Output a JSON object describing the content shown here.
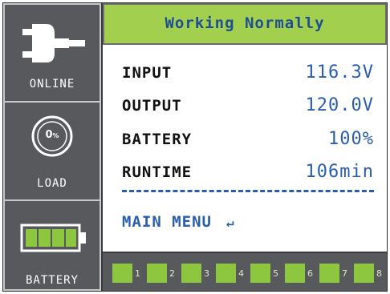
{
  "sidebar": {
    "online_label": "ONLINE",
    "load_label": "LOAD",
    "load_value": "0",
    "load_unit": "%",
    "battery_label": "BATTERY",
    "battery_level_fraction": 1.0
  },
  "status": {
    "text": "Working Normally"
  },
  "readings": [
    {
      "key": "INPUT",
      "value": "116.3V"
    },
    {
      "key": "OUTPUT",
      "value": "120.0V"
    },
    {
      "key": "BATTERY",
      "value": "100%"
    },
    {
      "key": "RUNTIME",
      "value": "106min"
    }
  ],
  "menu": {
    "label": "MAIN MENU",
    "enter_icon": "enter-icon"
  },
  "outlets": [
    {
      "num": "1"
    },
    {
      "num": "2"
    },
    {
      "num": "3"
    },
    {
      "num": "4"
    },
    {
      "num": "5"
    },
    {
      "num": "6"
    },
    {
      "num": "7"
    },
    {
      "num": "8"
    }
  ],
  "colors": {
    "status_bg": "#a2cf4e",
    "value_blue": "#2a5db0",
    "outlet_green": "#8dc63f",
    "panel_dark": "#57595c"
  }
}
